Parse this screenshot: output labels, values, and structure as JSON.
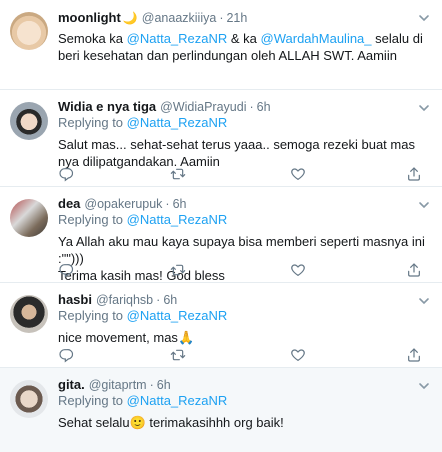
{
  "tweets": [
    {
      "name": "moonlight",
      "handle": "@anaazkiiiya",
      "time": "21h",
      "sep": "·",
      "body_parts": [
        "Semoka ka ",
        "@Natta_RezaNR",
        " & ka ",
        "@WardahMaulina_",
        " selalu di beri kesehatan dan perlindungan oleh ALLAH SWT. Aamiin"
      ]
    },
    {
      "name": "Widia e nya tiga",
      "handle": "@WidiaPrayudi",
      "time": "6h",
      "sep": "·",
      "reply_prefix": "Replying to ",
      "reply_to": "@Natta_RezaNR",
      "body": "Salut mas... sehat-sehat terus yaaa.. semoga rezeki buat mas nya dilipatgandakan. Aamiin"
    },
    {
      "name": "dea",
      "handle": "@opakerupuk",
      "time": "6h",
      "sep": "·",
      "reply_prefix": "Replying to ",
      "reply_to": "@Natta_RezaNR",
      "body_line1": "Ya Allah aku mau kaya supaya bisa memberi seperti masnya ini :\"\")))",
      "body_line2": "Terima kasih mas! God bless"
    },
    {
      "name": "hasbi",
      "handle": "@fariqhsb",
      "time": "6h",
      "sep": "·",
      "reply_prefix": "Replying to ",
      "reply_to": "@Natta_RezaNR",
      "body": "nice movement, mas",
      "emoji": "🙏"
    },
    {
      "name": "gita.",
      "handle": "@gitaprtm",
      "time": "6h",
      "sep": "·",
      "reply_prefix": "Replying to ",
      "reply_to": "@Natta_RezaNR",
      "body_before": "Sehat selalu",
      "emoji": "🙂",
      "body_after": " terimakasihhh org baik!"
    }
  ],
  "icons": {
    "reply": "reply-icon",
    "retweet": "retweet-icon",
    "like": "heart-icon",
    "share": "share-icon",
    "menu": "chevron-down-icon",
    "moon": "crescent-moon-icon"
  },
  "colors": {
    "link": "#1da1f2",
    "muted": "#657786",
    "text": "#14171a",
    "border": "#e6ecf0",
    "shaded": "#f5f8fa"
  }
}
